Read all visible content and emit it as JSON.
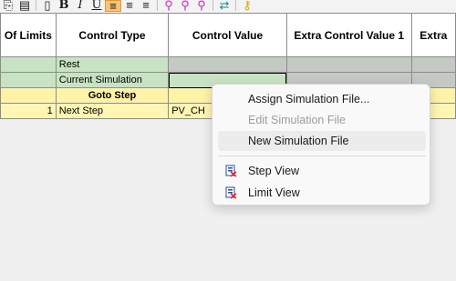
{
  "toolbar": {
    "bold": "B",
    "italic": "I",
    "underline": "U"
  },
  "grid": {
    "headers": [
      "Of Limits",
      "Control Type",
      "Control Value",
      "Extra Control Value 1",
      "Extra"
    ],
    "rows": [
      {
        "type": "green",
        "cells": [
          "",
          "Rest",
          "",
          "",
          ""
        ]
      },
      {
        "type": "green",
        "cells": [
          "",
          "Current Simulation",
          "",
          "",
          ""
        ]
      },
      {
        "type": "yellow-header",
        "cells": [
          "",
          "Goto Step",
          "",
          "",
          ""
        ]
      },
      {
        "type": "yellow",
        "cells": [
          "1",
          "Next Step",
          "PV_CH",
          "",
          ""
        ]
      }
    ]
  },
  "context_menu": {
    "items": [
      {
        "label": "Assign Simulation File...",
        "enabled": true,
        "icon": ""
      },
      {
        "label": "Edit Simulation File",
        "enabled": false,
        "icon": ""
      },
      {
        "label": "New Simulation File",
        "enabled": true,
        "icon": "",
        "highlighted": true
      },
      {
        "label": "Step View",
        "enabled": true,
        "icon": "step-view-icon"
      },
      {
        "label": "Limit View",
        "enabled": true,
        "icon": "limit-view-icon"
      }
    ]
  },
  "colors": {
    "green_row": "#c8e3c3",
    "gray_cell": "#c4c9c4",
    "yellow_row": "#fff3a8",
    "active_toolbar": "#f7c27a"
  }
}
